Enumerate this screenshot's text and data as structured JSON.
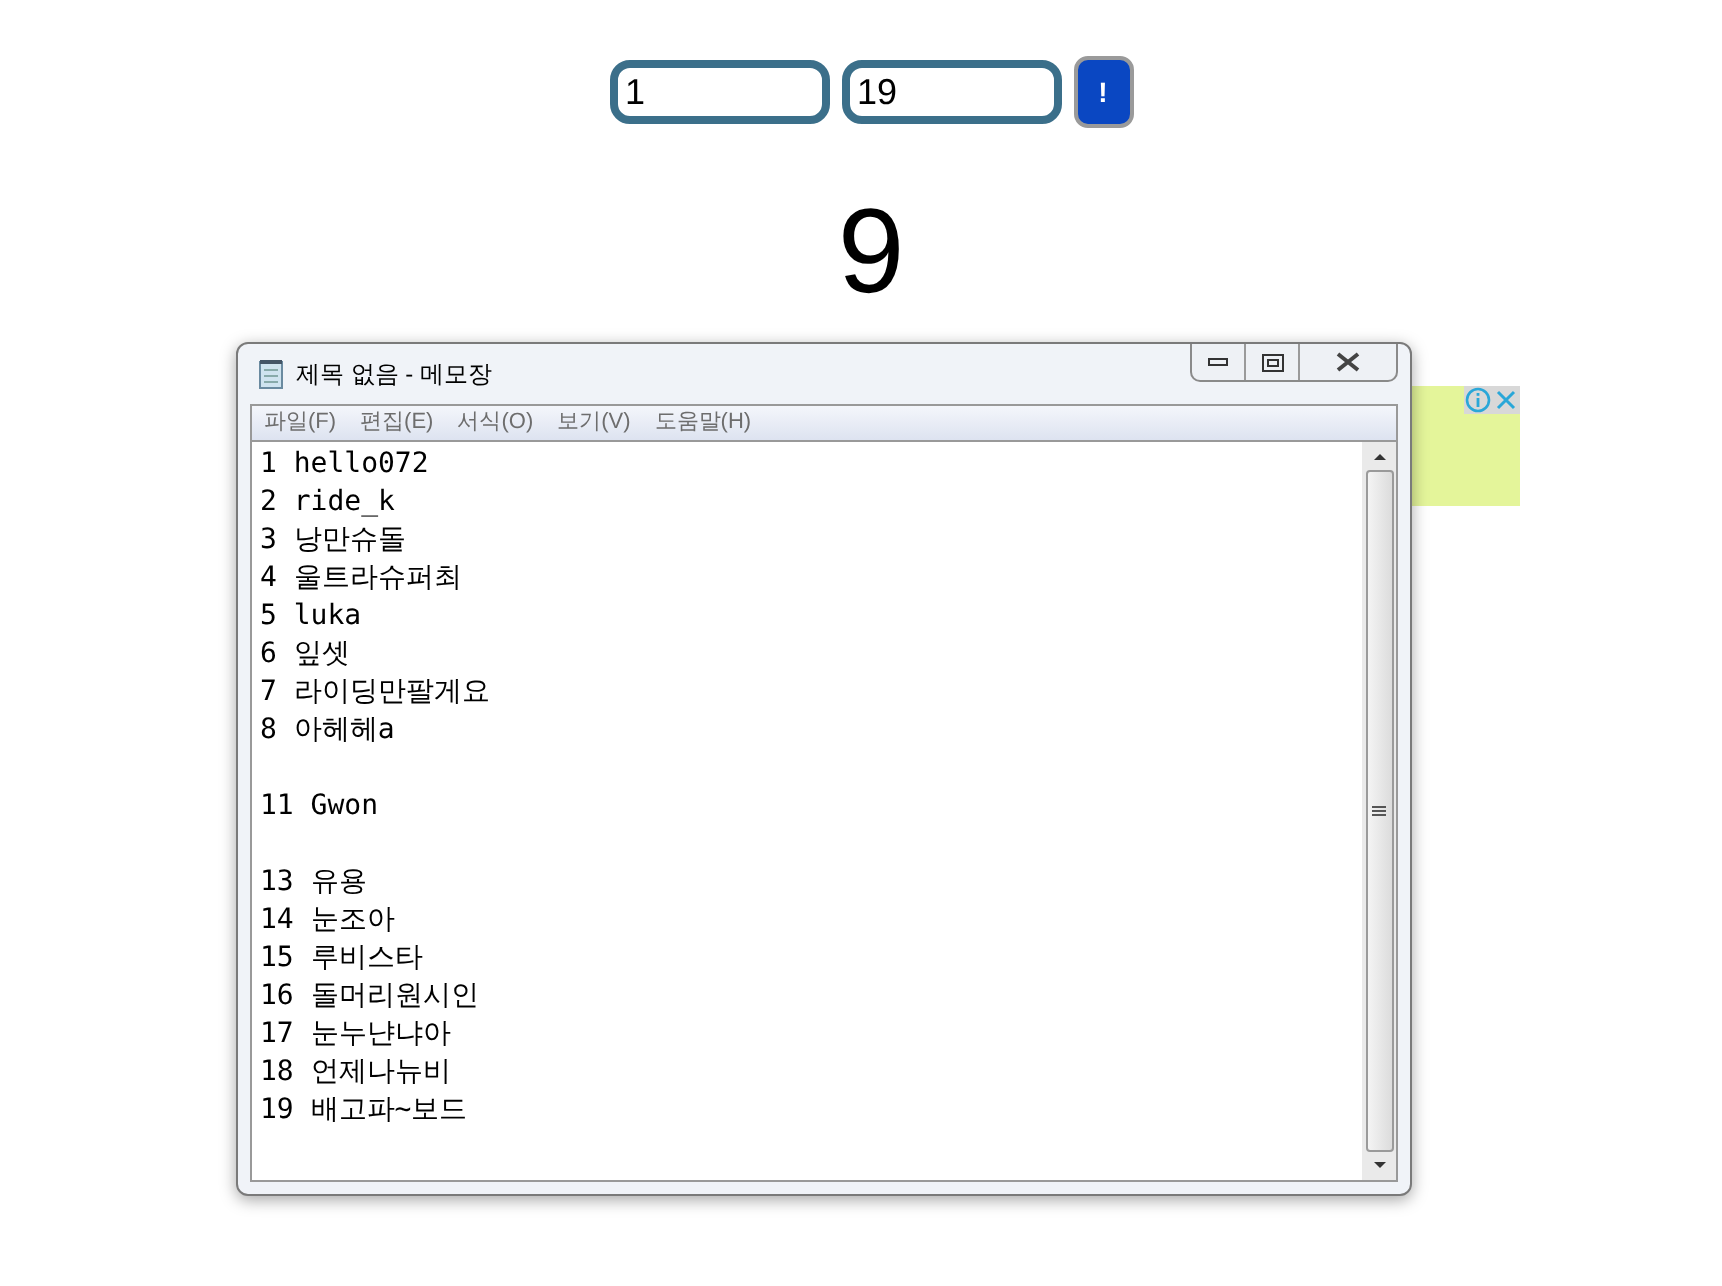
{
  "form": {
    "from_value": "1",
    "to_value": "19",
    "button_label": "!"
  },
  "result": "9",
  "notepad": {
    "title": "제목 없음 - 메모장",
    "menu": [
      "파일(F)",
      "편집(E)",
      "서식(O)",
      "보기(V)",
      "도움말(H)"
    ],
    "lines": [
      {
        "kind": "text",
        "text": "1 hello072"
      },
      {
        "kind": "text",
        "text": "2 ride_k"
      },
      {
        "kind": "text",
        "text": "3 낭만슈돌"
      },
      {
        "kind": "text",
        "text": "4 울트라슈퍼최"
      },
      {
        "kind": "text",
        "text": "5 luka"
      },
      {
        "kind": "text",
        "text": "6 잎셋"
      },
      {
        "kind": "text",
        "text": "7 라이딩만팔게요"
      },
      {
        "kind": "text",
        "text": "8 아헤헤a"
      },
      {
        "kind": "blank"
      },
      {
        "kind": "text",
        "text": "11 Gwon"
      },
      {
        "kind": "blank"
      },
      {
        "kind": "text",
        "text": "13 유용"
      },
      {
        "kind": "text",
        "text": "14 눈조아"
      },
      {
        "kind": "text",
        "text": "15 루비스타"
      },
      {
        "kind": "text",
        "text": "16 돌머리원시인"
      },
      {
        "kind": "text",
        "text": "17 눈누냔냐아"
      },
      {
        "kind": "text",
        "text": "18 언제나뉴비"
      },
      {
        "kind": "text",
        "text": "19 배고파~보드"
      }
    ]
  }
}
